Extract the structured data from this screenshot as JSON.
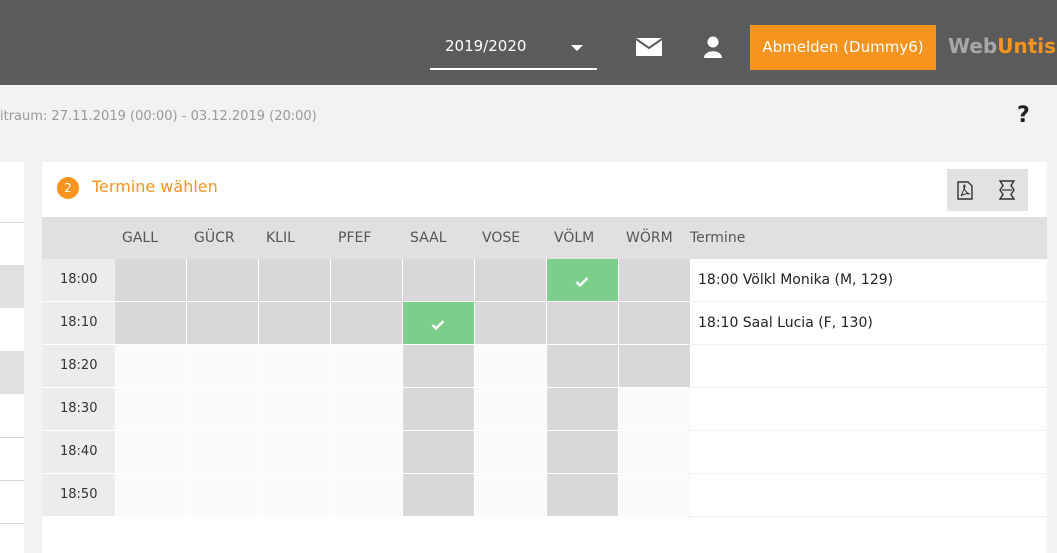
{
  "header": {
    "school_year": "2019/2020",
    "logout_label": "Abmelden (Dummy6)",
    "brand_web": "Web",
    "brand_untis": "Untis"
  },
  "subheader": {
    "period": "itraum: 27.11.2019 (00:00) - 03.12.2019 (20:00)",
    "help": "?"
  },
  "step": {
    "number": "2",
    "title": "Termine wählen"
  },
  "table": {
    "columns": [
      "GALL",
      "GÜCR",
      "KLIL",
      "PFEF",
      "SAAL",
      "VOSE",
      "VÖLM",
      "WÖRM"
    ],
    "appointments_header": "Termine",
    "rows": [
      {
        "time": "18:00",
        "appointment": "18:00 Völkl Monika (M, 129)"
      },
      {
        "time": "18:10",
        "appointment": "18:10 Saal Lucia (F, 130)"
      },
      {
        "time": "18:20",
        "appointment": ""
      },
      {
        "time": "18:30",
        "appointment": ""
      },
      {
        "time": "18:40",
        "appointment": ""
      },
      {
        "time": "18:50",
        "appointment": ""
      }
    ]
  },
  "colors": {
    "accent": "#f7941d",
    "topbar": "#5b5b5b",
    "booked": "#7ccf8a",
    "busy": "#d8d8d8"
  }
}
